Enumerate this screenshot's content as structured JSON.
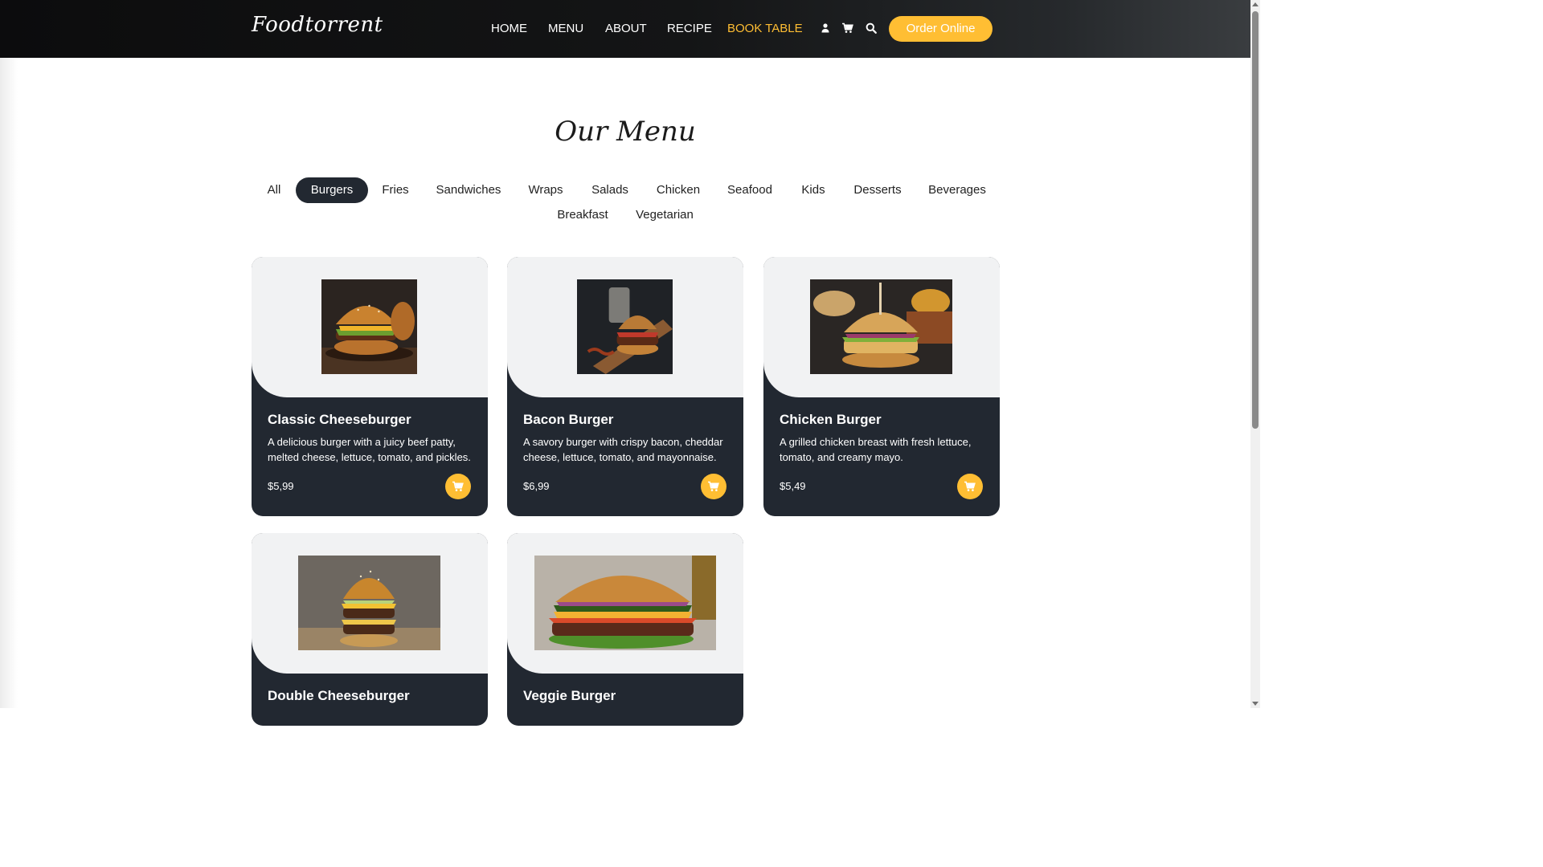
{
  "header": {
    "brand": "Foodtorrent",
    "nav": [
      "HOME",
      "MENU",
      "ABOUT",
      "RECIPE",
      "BOOK TABLE"
    ],
    "active_nav": "BOOK TABLE",
    "icons": [
      "user-icon",
      "cart-icon",
      "search-icon"
    ],
    "order_button": "Order Online"
  },
  "menu": {
    "heading": "Our Menu",
    "filters": [
      "All",
      "Burgers",
      "Fries",
      "Sandwiches",
      "Wraps",
      "Salads",
      "Chicken",
      "Seafood",
      "Kids",
      "Desserts",
      "Beverages",
      "Breakfast",
      "Vegetarian"
    ],
    "active_filter": "Burgers",
    "items": [
      {
        "name": "Classic Cheeseburger",
        "description": "A delicious burger with a juicy beef patty, melted cheese, lettuce, tomato, and pickles.",
        "price": "$5,99"
      },
      {
        "name": "Bacon Burger",
        "description": "A savory burger with crispy bacon, cheddar cheese, lettuce, tomato, and mayonnaise.",
        "price": "$6,99"
      },
      {
        "name": "Chicken Burger",
        "description": "A grilled chicken breast with fresh lettuce, tomato, and creamy mayo.",
        "price": "$5,49"
      },
      {
        "name": "Double Cheeseburger",
        "description": "",
        "price": ""
      },
      {
        "name": "Veggie Burger",
        "description": "",
        "price": ""
      }
    ]
  },
  "colors": {
    "accent": "#ffbe33",
    "dark": "#222831",
    "header_bg": "#0c0c0d",
    "card_top": "#f1f2f3"
  }
}
